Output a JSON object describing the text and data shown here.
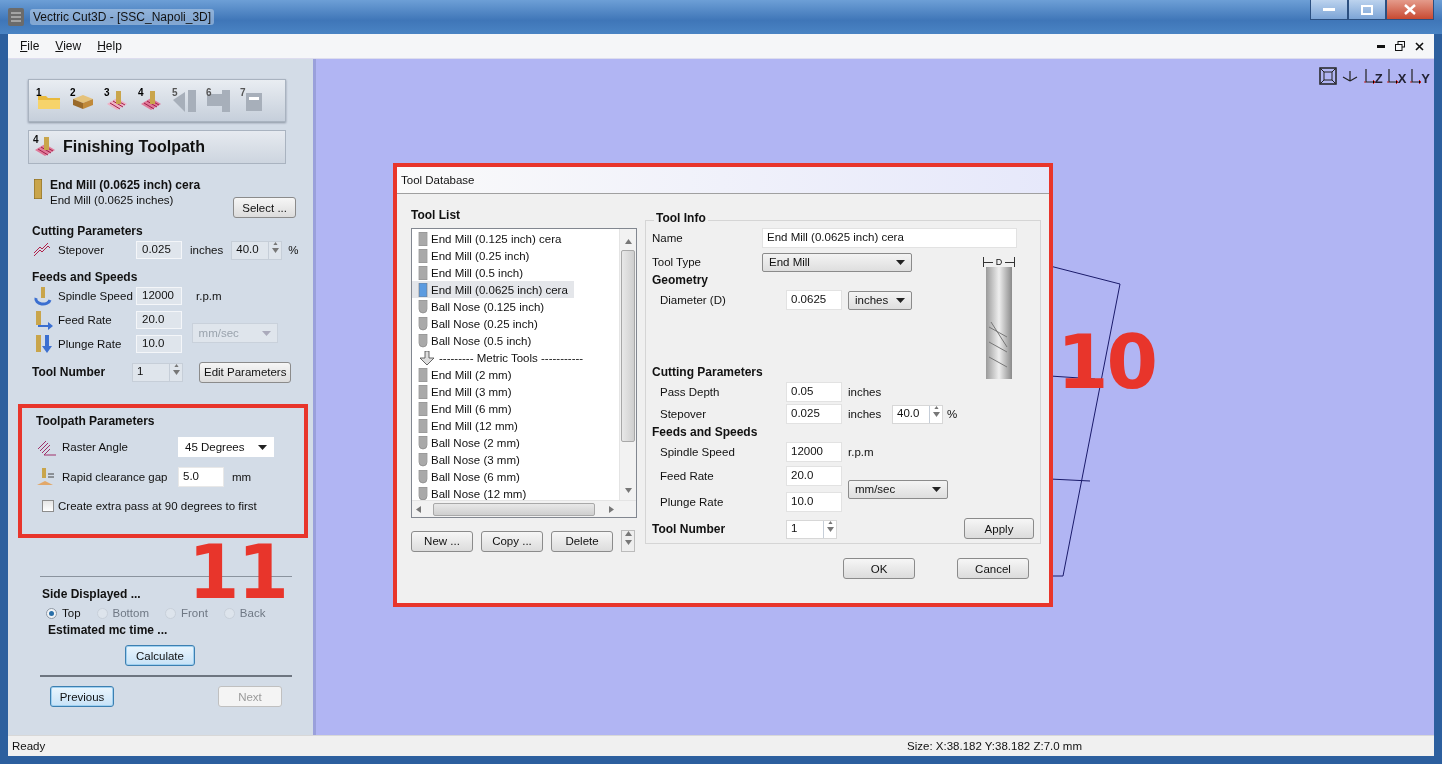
{
  "window": {
    "title": "Vectric Cut3D - [SSC_Napoli_3D]"
  },
  "menu": [
    "File",
    "View",
    "Help"
  ],
  "steps": [
    {
      "number": "1",
      "kind": "folder",
      "disabled": false
    },
    {
      "number": "2",
      "kind": "block",
      "disabled": false
    },
    {
      "number": "3",
      "kind": "roughing",
      "disabled": false
    },
    {
      "number": "4",
      "kind": "finishing",
      "disabled": false
    },
    {
      "number": "5",
      "kind": "cutout",
      "disabled": true
    },
    {
      "number": "6",
      "kind": "preview",
      "disabled": true
    },
    {
      "number": "7",
      "kind": "save",
      "disabled": true
    }
  ],
  "panel": {
    "heading": {
      "step": "4",
      "title": "Finishing Toolpath"
    },
    "tool": {
      "name": "End Mill (0.0625 inch) cera",
      "description": "End Mill (0.0625 inches)",
      "select_button": "Select ..."
    },
    "cutting_parameters": {
      "title": "Cutting Parameters",
      "label": "Stepover",
      "value": "0.025",
      "unit": "inches",
      "percent": "40.0",
      "percent_unit": "%"
    },
    "feeds": {
      "title": "Feeds and Speeds",
      "rows": [
        {
          "kind": "spindle",
          "label": "Spindle Speed",
          "value": "12000",
          "unit": "r.p.m"
        },
        {
          "kind": "feed",
          "label": "Feed Rate",
          "value": "20.0"
        },
        {
          "kind": "plunge",
          "label": "Plunge Rate",
          "value": "10.0"
        }
      ],
      "rate_unit": {
        "value": "mm/sec",
        "disabled": true
      }
    },
    "tool_number": {
      "label": "Tool Number",
      "value": "1",
      "button": "Edit Parameters"
    },
    "toolpath_parameters": {
      "title": "Toolpath Parameters",
      "raster_label": "Raster Angle",
      "raster_value": "45 Degrees",
      "clearance_label": "Rapid clearance gap",
      "clearance_value": "5.0",
      "clearance_unit": "mm",
      "extra_pass": {
        "label": "Create extra pass at 90 degrees to first",
        "checked": false
      }
    },
    "side_displayed": {
      "title": "Side Displayed ...",
      "options": [
        {
          "label": "Top",
          "selected": true,
          "disabled": false
        },
        {
          "label": "Bottom",
          "selected": false,
          "disabled": true
        },
        {
          "label": "Front",
          "selected": false,
          "disabled": true
        },
        {
          "label": "Back",
          "selected": false,
          "disabled": true
        }
      ]
    },
    "estimate": {
      "title": "Estimated mc time ...",
      "button": "Calculate"
    },
    "nav": [
      {
        "label": "Previous",
        "disabled": false
      },
      {
        "label": "Next",
        "disabled": true
      }
    ]
  },
  "view_buttons": [
    {
      "kind": "fit"
    },
    {
      "kind": "iso"
    },
    {
      "kind": "axis",
      "label": "Z"
    },
    {
      "kind": "axis",
      "label": "X"
    },
    {
      "kind": "axis",
      "label": "Y"
    }
  ],
  "dialog": {
    "title": "Tool Database",
    "tool_list": {
      "title": "Tool List",
      "items": [
        {
          "kind": "end_mill",
          "label": "End Mill (0.125 inch) cera",
          "selected": false
        },
        {
          "kind": "end_mill",
          "label": "End Mill (0.25 inch)",
          "selected": false
        },
        {
          "kind": "end_mill",
          "label": "End Mill (0.5 inch)",
          "selected": false
        },
        {
          "kind": "end_mill",
          "label": "End Mill (0.0625 inch) cera",
          "selected": true
        },
        {
          "kind": "ball_nose",
          "label": "Ball Nose (0.125 inch)",
          "selected": false
        },
        {
          "kind": "ball_nose",
          "label": "Ball Nose (0.25 inch)",
          "selected": false
        },
        {
          "kind": "ball_nose",
          "label": "Ball Nose (0.5 inch)",
          "selected": false
        },
        {
          "kind": "group",
          "label": "--------- Metric Tools -----------",
          "selected": false
        },
        {
          "kind": "end_mill",
          "label": "End Mill (2 mm)",
          "selected": false
        },
        {
          "kind": "end_mill",
          "label": "End Mill (3 mm)",
          "selected": false
        },
        {
          "kind": "end_mill",
          "label": "End Mill (6 mm)",
          "selected": false
        },
        {
          "kind": "end_mill",
          "label": "End Mill (12 mm)",
          "selected": false
        },
        {
          "kind": "ball_nose",
          "label": "Ball Nose (2 mm)",
          "selected": false
        },
        {
          "kind": "ball_nose",
          "label": "Ball Nose (3 mm)",
          "selected": false
        },
        {
          "kind": "ball_nose",
          "label": "Ball Nose (6 mm)",
          "selected": false
        },
        {
          "kind": "ball_nose",
          "label": "Ball Nose (12 mm)",
          "selected": false
        }
      ]
    },
    "list_buttons": [
      "New ...",
      "Copy ...",
      "Delete"
    ],
    "tool_info": {
      "title": "Tool Info",
      "name_label": "Name",
      "name": "End Mill (0.0625 inch) cera",
      "type_label": "Tool Type",
      "type": "End Mill",
      "geometry_title": "Geometry",
      "diameter_label": "Diameter (D)",
      "diameter": "0.0625",
      "diameter_unit": "inches",
      "dimension": "D",
      "cutting_title": "Cutting Parameters",
      "pass_depth_label": "Pass Depth",
      "pass_depth": "0.05",
      "pass_depth_unit": "inches",
      "stepover_label": "Stepover",
      "stepover": "0.025",
      "stepover_unit": "inches",
      "stepover_percent": "40.0",
      "percent_unit": "%",
      "feeds_title": "Feeds and Speeds",
      "spindle_label": "Spindle Speed",
      "spindle": "12000",
      "spindle_unit": "r.p.m",
      "feed_label": "Feed Rate",
      "feed": "20.0",
      "plunge_label": "Plunge Rate",
      "plunge": "10.0",
      "rate_unit": "mm/sec",
      "tool_number_label": "Tool Number",
      "tool_number": "1",
      "apply": "Apply"
    },
    "buttons": [
      "OK",
      "Cancel"
    ]
  },
  "annotations": [
    {
      "label": "10"
    },
    {
      "label": "11"
    }
  ],
  "status_bar": {
    "left": "Ready",
    "right": "Size: X:38.182 Y:38.182 Z:7.0 mm"
  }
}
